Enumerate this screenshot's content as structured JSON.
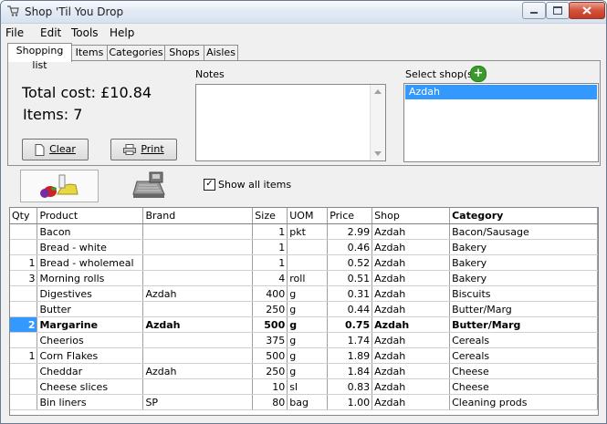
{
  "window": {
    "title": "Shop 'Til You Drop"
  },
  "menu": [
    {
      "label": "File"
    },
    {
      "label": "Edit"
    },
    {
      "label": "Tools"
    },
    {
      "label": "Help"
    }
  ],
  "tabs": [
    {
      "label": "Shopping list"
    },
    {
      "label": "Items"
    },
    {
      "label": "Categories"
    },
    {
      "label": "Shops"
    },
    {
      "label": "Aisles"
    }
  ],
  "summary": {
    "total": "Total cost: £10.84",
    "items": "Items: 7"
  },
  "buttons": {
    "clear": "Clear",
    "print": "Print"
  },
  "notes": {
    "label": "Notes",
    "value": ""
  },
  "shops": {
    "label": "Select shop(s)",
    "selected": "Azdah"
  },
  "show_all": {
    "label": "Show all items",
    "checked": true
  },
  "columns": [
    "Qty",
    "Product",
    "Brand",
    "Size",
    "UOM",
    "Price",
    "Shop",
    "Category"
  ],
  "rows": [
    {
      "qty": "",
      "product": "Bacon",
      "brand": "",
      "size": "1",
      "uom": "pkt",
      "price": "2.99",
      "shop": "Azdah",
      "category": "Bacon/Sausage"
    },
    {
      "qty": "",
      "product": "Bread - white",
      "brand": "",
      "size": "1",
      "uom": "",
      "price": "0.46",
      "shop": "Azdah",
      "category": "Bakery"
    },
    {
      "qty": "1",
      "product": "Bread - wholemeal",
      "brand": "",
      "size": "1",
      "uom": "",
      "price": "0.52",
      "shop": "Azdah",
      "category": "Bakery"
    },
    {
      "qty": "3",
      "product": "Morning rolls",
      "brand": "",
      "size": "4",
      "uom": "roll",
      "price": "0.51",
      "shop": "Azdah",
      "category": "Bakery"
    },
    {
      "qty": "",
      "product": "Digestives",
      "brand": "Azdah",
      "size": "400",
      "uom": "g",
      "price": "0.31",
      "shop": "Azdah",
      "category": "Biscuits"
    },
    {
      "qty": "",
      "product": "Butter",
      "brand": "",
      "size": "250",
      "uom": "g",
      "price": "0.44",
      "shop": "Azdah",
      "category": "Butter/Marg"
    },
    {
      "qty": "2",
      "product": "Margarine",
      "brand": "Azdah",
      "size": "500",
      "uom": "g",
      "price": "0.75",
      "shop": "Azdah",
      "category": "Butter/Marg"
    },
    {
      "qty": "",
      "product": "Cheerios",
      "brand": "",
      "size": "375",
      "uom": "g",
      "price": "1.74",
      "shop": "Azdah",
      "category": "Cereals"
    },
    {
      "qty": "1",
      "product": "Corn Flakes",
      "brand": "",
      "size": "500",
      "uom": "g",
      "price": "1.89",
      "shop": "Azdah",
      "category": "Cereals"
    },
    {
      "qty": "",
      "product": "Cheddar",
      "brand": "Azdah",
      "size": "250",
      "uom": "g",
      "price": "1.84",
      "shop": "Azdah",
      "category": "Cheese"
    },
    {
      "qty": "",
      "product": "Cheese slices",
      "brand": "",
      "size": "10",
      "uom": "sl",
      "price": "0.83",
      "shop": "Azdah",
      "category": "Cheese"
    },
    {
      "qty": "",
      "product": "Bin liners",
      "brand": "SP",
      "size": "80",
      "uom": "bag",
      "price": "1.00",
      "shop": "Azdah",
      "category": "Cleaning prods"
    }
  ]
}
